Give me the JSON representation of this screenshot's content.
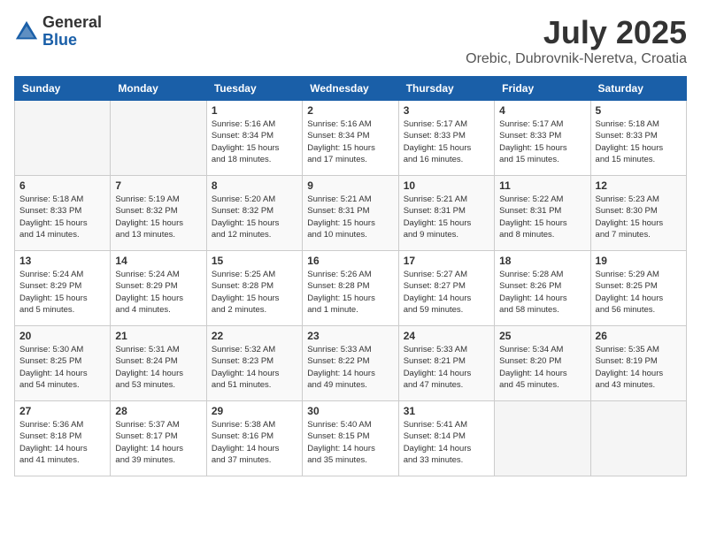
{
  "header": {
    "logo_general": "General",
    "logo_blue": "Blue",
    "month_title": "July 2025",
    "location": "Orebic, Dubrovnik-Neretva, Croatia"
  },
  "weekdays": [
    "Sunday",
    "Monday",
    "Tuesday",
    "Wednesday",
    "Thursday",
    "Friday",
    "Saturday"
  ],
  "weeks": [
    [
      {
        "day": "",
        "info": ""
      },
      {
        "day": "",
        "info": ""
      },
      {
        "day": "1",
        "info": "Sunrise: 5:16 AM\nSunset: 8:34 PM\nDaylight: 15 hours\nand 18 minutes."
      },
      {
        "day": "2",
        "info": "Sunrise: 5:16 AM\nSunset: 8:34 PM\nDaylight: 15 hours\nand 17 minutes."
      },
      {
        "day": "3",
        "info": "Sunrise: 5:17 AM\nSunset: 8:33 PM\nDaylight: 15 hours\nand 16 minutes."
      },
      {
        "day": "4",
        "info": "Sunrise: 5:17 AM\nSunset: 8:33 PM\nDaylight: 15 hours\nand 15 minutes."
      },
      {
        "day": "5",
        "info": "Sunrise: 5:18 AM\nSunset: 8:33 PM\nDaylight: 15 hours\nand 15 minutes."
      }
    ],
    [
      {
        "day": "6",
        "info": "Sunrise: 5:18 AM\nSunset: 8:33 PM\nDaylight: 15 hours\nand 14 minutes."
      },
      {
        "day": "7",
        "info": "Sunrise: 5:19 AM\nSunset: 8:32 PM\nDaylight: 15 hours\nand 13 minutes."
      },
      {
        "day": "8",
        "info": "Sunrise: 5:20 AM\nSunset: 8:32 PM\nDaylight: 15 hours\nand 12 minutes."
      },
      {
        "day": "9",
        "info": "Sunrise: 5:21 AM\nSunset: 8:31 PM\nDaylight: 15 hours\nand 10 minutes."
      },
      {
        "day": "10",
        "info": "Sunrise: 5:21 AM\nSunset: 8:31 PM\nDaylight: 15 hours\nand 9 minutes."
      },
      {
        "day": "11",
        "info": "Sunrise: 5:22 AM\nSunset: 8:31 PM\nDaylight: 15 hours\nand 8 minutes."
      },
      {
        "day": "12",
        "info": "Sunrise: 5:23 AM\nSunset: 8:30 PM\nDaylight: 15 hours\nand 7 minutes."
      }
    ],
    [
      {
        "day": "13",
        "info": "Sunrise: 5:24 AM\nSunset: 8:29 PM\nDaylight: 15 hours\nand 5 minutes."
      },
      {
        "day": "14",
        "info": "Sunrise: 5:24 AM\nSunset: 8:29 PM\nDaylight: 15 hours\nand 4 minutes."
      },
      {
        "day": "15",
        "info": "Sunrise: 5:25 AM\nSunset: 8:28 PM\nDaylight: 15 hours\nand 2 minutes."
      },
      {
        "day": "16",
        "info": "Sunrise: 5:26 AM\nSunset: 8:28 PM\nDaylight: 15 hours\nand 1 minute."
      },
      {
        "day": "17",
        "info": "Sunrise: 5:27 AM\nSunset: 8:27 PM\nDaylight: 14 hours\nand 59 minutes."
      },
      {
        "day": "18",
        "info": "Sunrise: 5:28 AM\nSunset: 8:26 PM\nDaylight: 14 hours\nand 58 minutes."
      },
      {
        "day": "19",
        "info": "Sunrise: 5:29 AM\nSunset: 8:25 PM\nDaylight: 14 hours\nand 56 minutes."
      }
    ],
    [
      {
        "day": "20",
        "info": "Sunrise: 5:30 AM\nSunset: 8:25 PM\nDaylight: 14 hours\nand 54 minutes."
      },
      {
        "day": "21",
        "info": "Sunrise: 5:31 AM\nSunset: 8:24 PM\nDaylight: 14 hours\nand 53 minutes."
      },
      {
        "day": "22",
        "info": "Sunrise: 5:32 AM\nSunset: 8:23 PM\nDaylight: 14 hours\nand 51 minutes."
      },
      {
        "day": "23",
        "info": "Sunrise: 5:33 AM\nSunset: 8:22 PM\nDaylight: 14 hours\nand 49 minutes."
      },
      {
        "day": "24",
        "info": "Sunrise: 5:33 AM\nSunset: 8:21 PM\nDaylight: 14 hours\nand 47 minutes."
      },
      {
        "day": "25",
        "info": "Sunrise: 5:34 AM\nSunset: 8:20 PM\nDaylight: 14 hours\nand 45 minutes."
      },
      {
        "day": "26",
        "info": "Sunrise: 5:35 AM\nSunset: 8:19 PM\nDaylight: 14 hours\nand 43 minutes."
      }
    ],
    [
      {
        "day": "27",
        "info": "Sunrise: 5:36 AM\nSunset: 8:18 PM\nDaylight: 14 hours\nand 41 minutes."
      },
      {
        "day": "28",
        "info": "Sunrise: 5:37 AM\nSunset: 8:17 PM\nDaylight: 14 hours\nand 39 minutes."
      },
      {
        "day": "29",
        "info": "Sunrise: 5:38 AM\nSunset: 8:16 PM\nDaylight: 14 hours\nand 37 minutes."
      },
      {
        "day": "30",
        "info": "Sunrise: 5:40 AM\nSunset: 8:15 PM\nDaylight: 14 hours\nand 35 minutes."
      },
      {
        "day": "31",
        "info": "Sunrise: 5:41 AM\nSunset: 8:14 PM\nDaylight: 14 hours\nand 33 minutes."
      },
      {
        "day": "",
        "info": ""
      },
      {
        "day": "",
        "info": ""
      }
    ]
  ]
}
